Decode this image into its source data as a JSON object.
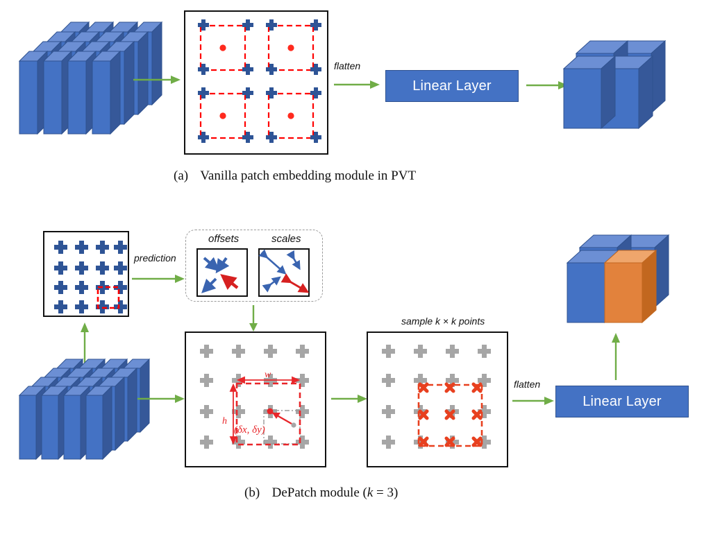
{
  "figure": {
    "panels": [
      {
        "id": "a",
        "caption_prefix": "(a)",
        "caption_text": "Vanilla patch embedding module in PVT",
        "flatten_label": "flatten",
        "linear_layer_label": "Linear Layer",
        "patch_grid": {
          "patches": 4,
          "corner_markers_per_patch": 4,
          "center_dot_per_patch": 1,
          "marker_glyph": "plus",
          "center_glyph": "dot"
        }
      },
      {
        "id": "b",
        "caption_prefix": "(b)",
        "caption_text": "DePatch module (",
        "caption_math_k": "k",
        "caption_math_tail": " = 3)",
        "prediction_label": "prediction",
        "offsets_label": "offsets",
        "scales_label": "scales",
        "sample_label": "sample k × k points",
        "flatten_label": "flatten",
        "linear_layer_label": "Linear Layer",
        "width_label": "w",
        "height_label": "h",
        "delta_label": "(δx, δy)",
        "feature_grid": {
          "rows": 4,
          "cols": 4,
          "marker_glyph": "plus"
        },
        "sample_grid": {
          "k": 3,
          "marker_glyph": "cross"
        }
      }
    ],
    "colors": {
      "block_blue_face": "#4472C4",
      "block_blue_top": "#6C8FD4",
      "block_blue_side": "#365899",
      "block_orange_face": "#E2823C",
      "block_orange_top": "#EFA66C",
      "block_orange_side": "#C2671F",
      "arrow_green": "#70AD47",
      "marker_blue": "#2E5496",
      "marker_gray": "#A6A6A6",
      "dashed_red": "#FF0000",
      "sample_red": "#E8401F",
      "linear_layer_fill": "#4472C4",
      "linear_layer_text": "#FFFFFF",
      "box_border": "#111111",
      "dashed_gray": "#9A9A9A",
      "annotation_red": "#E8262A"
    }
  }
}
